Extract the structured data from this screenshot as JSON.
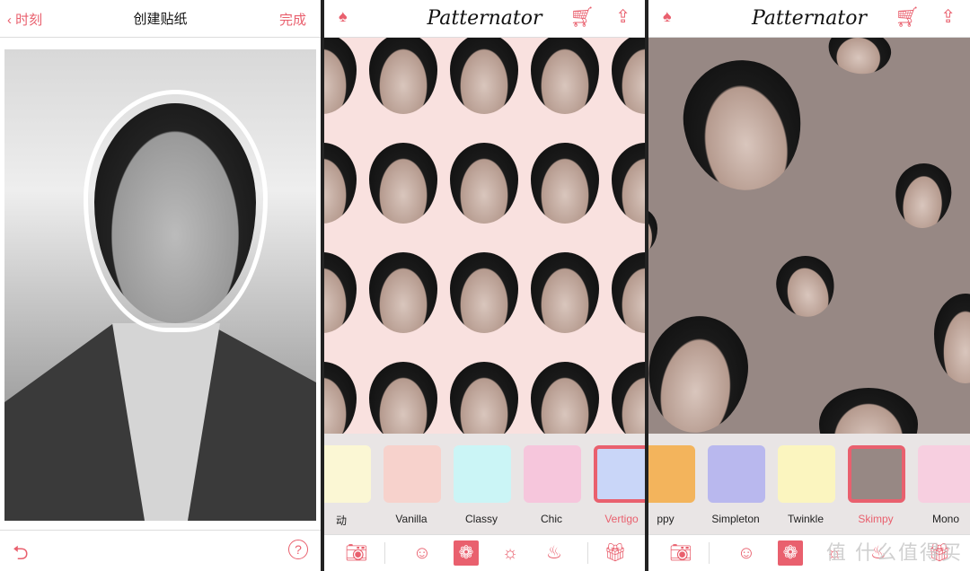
{
  "editor": {
    "back_label": "时刻",
    "title": "创建贴纸",
    "done_label": "完成",
    "undo_icon": "undo-icon",
    "help_label": "?"
  },
  "app": {
    "logo": "Patternator",
    "accent": "#e9606e"
  },
  "screen2": {
    "background": "#f9e1df",
    "patterns": [
      {
        "label": "动",
        "color": "#fbf7d4"
      },
      {
        "label": "Vanilla",
        "color": "#f7d2cc"
      },
      {
        "label": "Classy",
        "color": "#cbf5f6"
      },
      {
        "label": "Chic",
        "color": "#f6c6dc"
      },
      {
        "label": "Vertigo",
        "color": "#c9d6f8",
        "selected": true
      }
    ]
  },
  "screen3": {
    "background": "#978884",
    "patterns": [
      {
        "label": "ppy",
        "color": "#f3b45c"
      },
      {
        "label": "Simpleton",
        "color": "#b9b8ee"
      },
      {
        "label": "Twinkle",
        "color": "#fbf5bf"
      },
      {
        "label": "Skimpy",
        "color": "#978884",
        "selected": true
      },
      {
        "label": "Mono",
        "color": "#f7cfe0"
      }
    ]
  },
  "watermark": "值 什么值得买"
}
